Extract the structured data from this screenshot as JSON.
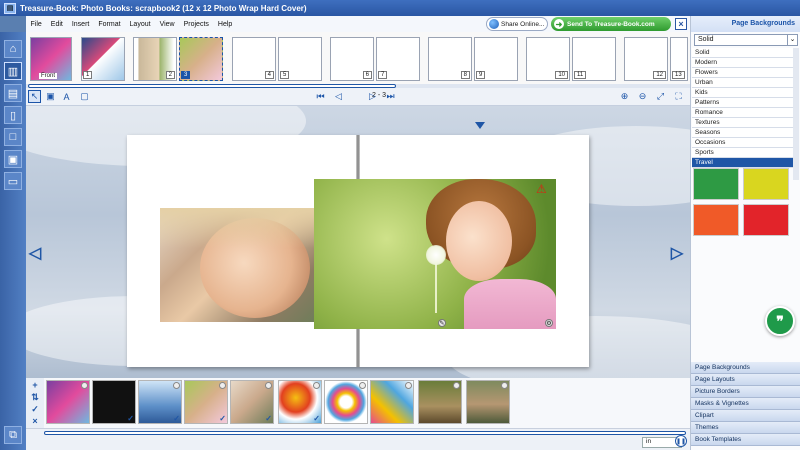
{
  "window": {
    "title": "Treasure-Book: Photo Books: scrapbook2 (12 x 12 Photo Wrap Hard Cover)",
    "icon": "app-icon"
  },
  "menu": [
    "File",
    "Edit",
    "Insert",
    "Format",
    "Layout",
    "View",
    "Projects",
    "Help"
  ],
  "header_actions": {
    "share_label": "Share Online...",
    "send_label": "Send To Treasure-Book.com"
  },
  "pages_strip": {
    "front_label": "Front",
    "page_numbers": [
      "1",
      "2",
      "3",
      "4",
      "5",
      "6",
      "7",
      "8",
      "9",
      "10",
      "11",
      "12",
      "13"
    ],
    "selected_page": "3"
  },
  "toolbar": {
    "page_range": "2 - 3"
  },
  "right_panel": {
    "title": "Page Backgrounds",
    "select_value": "Solid",
    "categories": [
      "Solid",
      "Modern",
      "Flowers",
      "Urban",
      "Kids",
      "Patterns",
      "Romance",
      "Textures",
      "Seasons",
      "Occasions",
      "Sports",
      "Travel"
    ],
    "selected_category": "Travel",
    "swatches": [
      "#2e9a44",
      "#d9d61f",
      "#f05a28",
      "#e2242a"
    ],
    "sections": [
      "Page Backgrounds",
      "Page Layouts",
      "Picture Borders",
      "Masks & Vignettes",
      "Clipart",
      "Themes",
      "Book Templates"
    ]
  },
  "status": {
    "unit": "in"
  },
  "colors": {
    "accent": "#1f56a6",
    "send_green": "#2f9a2f",
    "fab_green": "#1f9a4a"
  }
}
